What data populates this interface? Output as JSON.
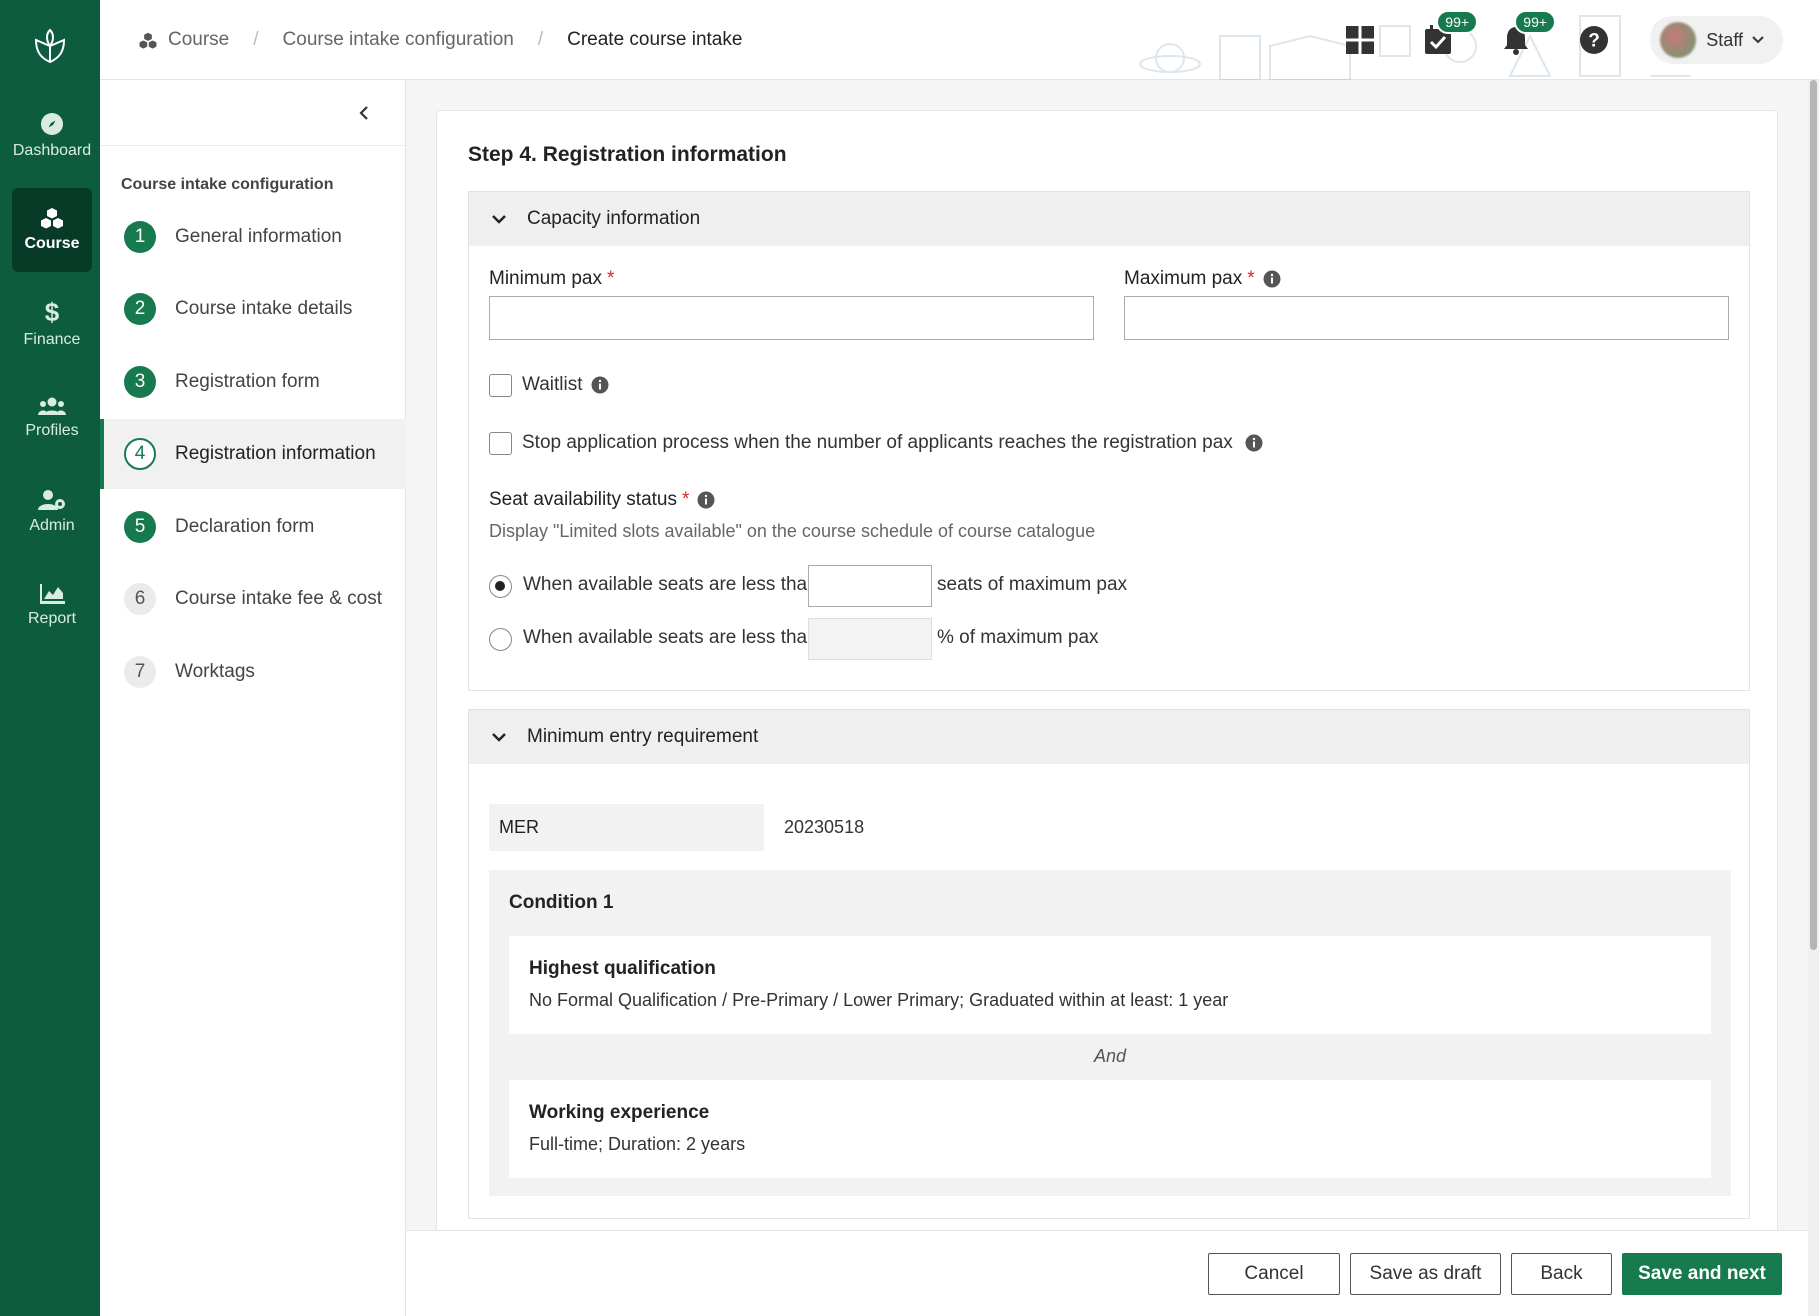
{
  "nav": {
    "items": [
      {
        "label": "Dashboard",
        "icon": "compass-icon"
      },
      {
        "label": "Course",
        "icon": "cubes-icon",
        "active": true
      },
      {
        "label": "Finance",
        "icon": "dollar-icon"
      },
      {
        "label": "Profiles",
        "icon": "users-icon"
      },
      {
        "label": "Admin",
        "icon": "user-gear-icon"
      },
      {
        "label": "Report",
        "icon": "chart-icon"
      }
    ]
  },
  "breadcrumb": {
    "items": [
      "Course",
      "Course intake configuration",
      "Create course intake"
    ]
  },
  "topbar": {
    "tasks_badge": "99+",
    "notifications_badge": "99+",
    "user_label": "Staff"
  },
  "steps": {
    "title": "Course intake configuration",
    "items": [
      {
        "num": "1",
        "label": "General information",
        "state": "done"
      },
      {
        "num": "2",
        "label": "Course intake details",
        "state": "done"
      },
      {
        "num": "3",
        "label": "Registration form",
        "state": "done"
      },
      {
        "num": "4",
        "label": "Registration information",
        "state": "current"
      },
      {
        "num": "5",
        "label": "Declaration form",
        "state": "done"
      },
      {
        "num": "6",
        "label": "Course intake fee & cost",
        "state": "todo"
      },
      {
        "num": "7",
        "label": "Worktags",
        "state": "todo"
      }
    ]
  },
  "main": {
    "title": "Step 4. Registration information",
    "capacity": {
      "heading": "Capacity information",
      "min_pax_label": "Minimum pax",
      "min_pax_value": "",
      "max_pax_label": "Maximum pax",
      "max_pax_value": "",
      "required_mark": "*",
      "waitlist_label": "Waitlist",
      "stop_label": "Stop application process when the number of applicants reaches the registration pax",
      "seat_label": "Seat availability status",
      "seat_help": "Display \"Limited slots available\" on the course schedule of course catalogue",
      "option1_prefix": "When available seats are less than",
      "option1_suffix": "seats of maximum pax",
      "option1_value": "",
      "option2_prefix": "When available seats are less than",
      "option2_suffix": "% of maximum pax",
      "option2_value": ""
    },
    "mer": {
      "heading": "Minimum entry requirement",
      "label": "MER",
      "value": "20230518",
      "condition_title": "Condition 1",
      "qualification_heading": "Highest qualification",
      "qualification_detail": "No Formal Qualification / Pre-Primary / Lower Primary; Graduated within at least: 1 year",
      "and_label": "And",
      "experience_heading": "Working experience",
      "experience_detail": "Full-time; Duration: 2 years"
    }
  },
  "footer": {
    "cancel": "Cancel",
    "save_draft": "Save as draft",
    "back": "Back",
    "save_next": "Save and next"
  },
  "colors": {
    "brand": "#0e5c3f",
    "accent": "#167a4e",
    "required": "#d12b2b"
  }
}
